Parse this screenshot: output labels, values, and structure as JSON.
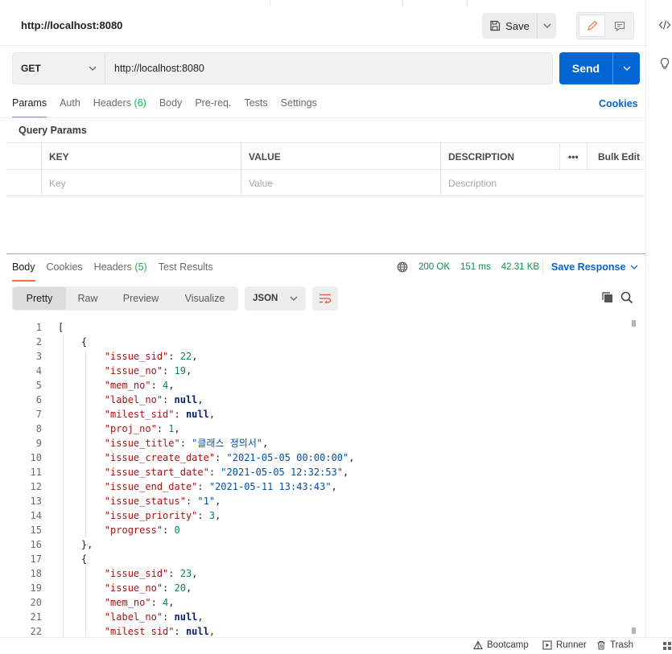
{
  "request": {
    "title": "http://localhost:8080",
    "save_label": "Save",
    "method": "GET",
    "url": "http://localhost:8080",
    "send_label": "Send"
  },
  "request_tabs": [
    {
      "label": "Params",
      "count": ""
    },
    {
      "label": "Auth",
      "count": ""
    },
    {
      "label": "Headers",
      "count": "(6)"
    },
    {
      "label": "Body",
      "count": ""
    },
    {
      "label": "Pre-req.",
      "count": ""
    },
    {
      "label": "Tests",
      "count": ""
    },
    {
      "label": "Settings",
      "count": ""
    }
  ],
  "cookies_label": "Cookies",
  "query_params": {
    "title": "Query Params",
    "headers": {
      "key": "KEY",
      "value": "VALUE",
      "description": "DESCRIPTION",
      "more": "•••",
      "bulk_edit": "Bulk Edit"
    },
    "placeholders": {
      "key": "Key",
      "value": "Value",
      "description": "Description"
    }
  },
  "response": {
    "tabs": [
      {
        "label": "Body",
        "count": ""
      },
      {
        "label": "Cookies",
        "count": ""
      },
      {
        "label": "Headers",
        "count": "(5)"
      },
      {
        "label": "Test Results",
        "count": ""
      }
    ],
    "status": "200 OK",
    "time": "151 ms",
    "size": "42.31 KB",
    "save_response_label": "Save Response",
    "view_tabs": [
      "Pretty",
      "Raw",
      "Preview",
      "Visualize"
    ],
    "format": "JSON"
  },
  "code_lines": [
    "[",
    "    {",
    "        \"issue_sid\": 22,",
    "        \"issue_no\": 19,",
    "        \"mem_no\": 4,",
    "        \"label_no\": null,",
    "        \"milest_sid\": null,",
    "        \"proj_no\": 1,",
    "        \"issue_title\": \"클래스 정의서\",",
    "        \"issue_create_date\": \"2021-05-05 00:00:00\",",
    "        \"issue_start_date\": \"2021-05-05 12:32:53\",",
    "        \"issue_end_date\": \"2021-05-11 13:43:43\",",
    "        \"issue_status\": \"1\",",
    "        \"issue_priority\": 3,",
    "        \"progress\": 0",
    "    },",
    "    {",
    "        \"issue_sid\": 23,",
    "        \"issue_no\": 20,",
    "        \"mem_no\": 4,",
    "        \"label_no\": null,",
    "        \"milest_sid\": null,"
  ],
  "footer": {
    "bootcamp": "Bootcamp",
    "runner": "Runner",
    "trash": "Trash"
  },
  "colors": {
    "accent_orange": "#ff6c37",
    "send_blue": "#0265d2",
    "status_green": "#0c8f4a"
  }
}
